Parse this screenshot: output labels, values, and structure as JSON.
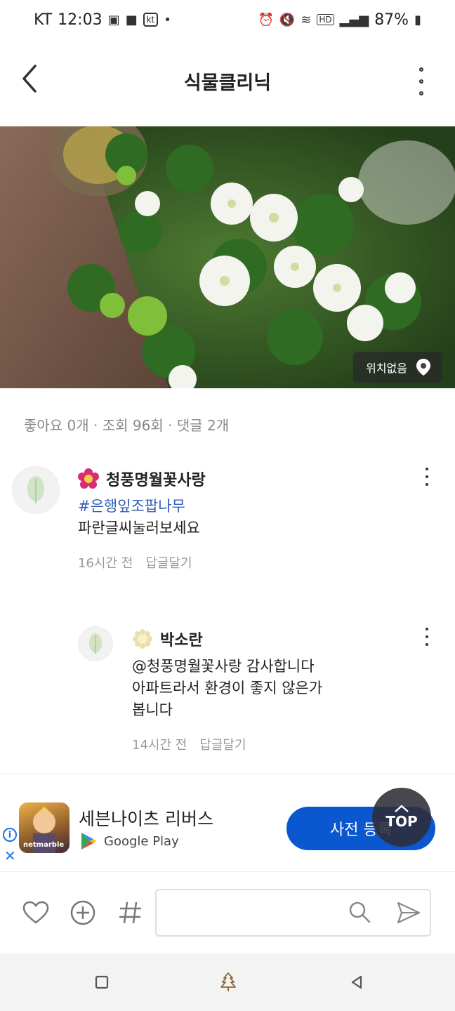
{
  "status_bar": {
    "carrier": "KT",
    "time": "12:03",
    "carrier_badge": "kt",
    "battery": "87%",
    "icons": [
      "image-icon",
      "video-icon",
      "kt-icon",
      "alarm-icon",
      "mute-icon",
      "wifi-icon",
      "hd-icon",
      "signal-icon",
      "battery-icon"
    ]
  },
  "header": {
    "title": "식물클리닉"
  },
  "photo": {
    "location_label": "위치없음"
  },
  "stats": {
    "text": "좋아요 0개 · 조회 96회 · 댓글 2개"
  },
  "comments": [
    {
      "username": "청풍명월꽃사랑",
      "hashtag": "#은행잎조팝나무",
      "text": "파란글씨눌러보세요",
      "time": "16시간 전",
      "reply_label": "답글달기"
    },
    {
      "username": "박소란",
      "line1": "@청풍명월꽃사랑 감사합니다",
      "line2": "아파트라서 환경이 좋지 않은가",
      "line3": "봅니다",
      "time": "14시간 전",
      "reply_label": "답글달기"
    }
  ],
  "ad": {
    "app_name": "세븐나이츠 리버스",
    "store": "Google Play",
    "cta": "사전 등록",
    "icon_label": "netmarble",
    "info": "i",
    "close": "✕"
  },
  "top_button": {
    "label": "TOP"
  },
  "colors": {
    "hashtag": "#2e5bb8",
    "cta": "#0b57d0",
    "nav_bar": "#f3f3f3"
  }
}
